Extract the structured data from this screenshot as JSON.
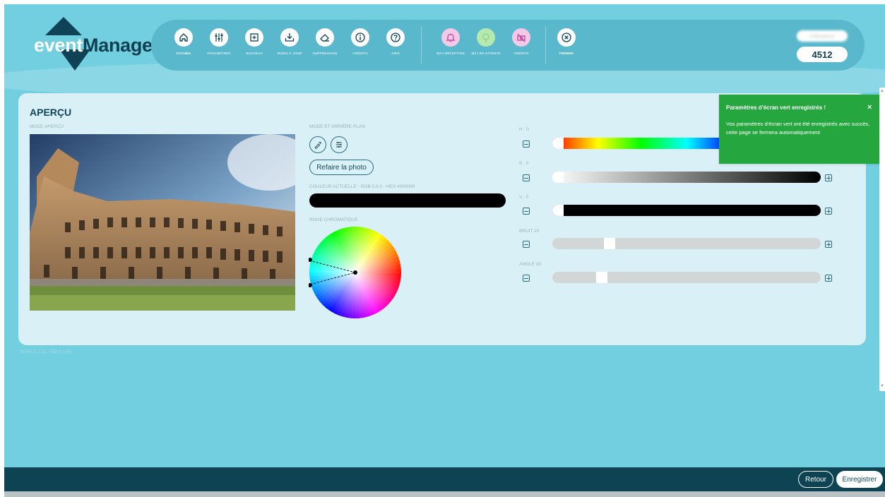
{
  "header": {
    "logo": {
      "part1": "event",
      "part2": "Manager"
    },
    "toolbar": [
      {
        "label": "ACCUEIL",
        "icon": "home-icon"
      },
      {
        "label": "PARAMÈTRES",
        "icon": "sliders-icon"
      },
      {
        "label": "NOUVEAU",
        "icon": "plus-square-icon"
      },
      {
        "label": "MISES À JOUR",
        "icon": "download-icon"
      },
      {
        "label": "SUPPRESSION",
        "icon": "eraser-icon"
      },
      {
        "label": "CRÉDITS",
        "icon": "info-icon"
      },
      {
        "label": "AIDE",
        "icon": "help-icon"
      },
      {
        "label": "MÀJ RÉCEPTION",
        "icon": "bell-icon"
      },
      {
        "label": "MÀJ EN ATTENTE",
        "icon": "lightbulb-icon"
      },
      {
        "label": "CRÉDITS",
        "icon": "no-money-icon"
      },
      {
        "label": "FERMER",
        "icon": "close-circle-icon"
      }
    ],
    "user_name": "Utilisateur",
    "count": "4512"
  },
  "panel": {
    "title": "APERÇU",
    "preview_label": "MODE APERÇU",
    "mode_label": "MODE ET ARRIÈRE-PLAN",
    "retake_label": "Refaire la photo",
    "current_color_label": "COULEUR ACTUELLE - RGB 0,0,0 - HEX #000000",
    "current_color": "#000000",
    "wheel_label": "ROUE CHROMATIQUE",
    "sliders": [
      {
        "label": "H : 0",
        "type": "hue",
        "value": 0
      },
      {
        "label": "S : 0",
        "type": "saturation",
        "value": 0
      },
      {
        "label": "V : 0",
        "type": "value",
        "value": 0
      },
      {
        "label": "BRUIT 20",
        "type": "gray",
        "value": 0.2
      },
      {
        "label": "ANGLE 30",
        "type": "gray",
        "value": 0.17
      }
    ]
  },
  "version": "SERV 1.2.15 - EM 5.0.65",
  "toast": {
    "title": "Paramètres d'écran vert enregistrés !",
    "close": "×",
    "message": "Vos paramètres d'écran vert ont été enregistrés avec succès, cette page se fermera automatiquement"
  },
  "footer": {
    "back_label": "Retour",
    "save_label": "Enregistrer"
  },
  "colors": {
    "background": "#72cfe0",
    "panel": "#d9f0f6",
    "dark": "#0d4353",
    "toast": "#26a63f"
  }
}
